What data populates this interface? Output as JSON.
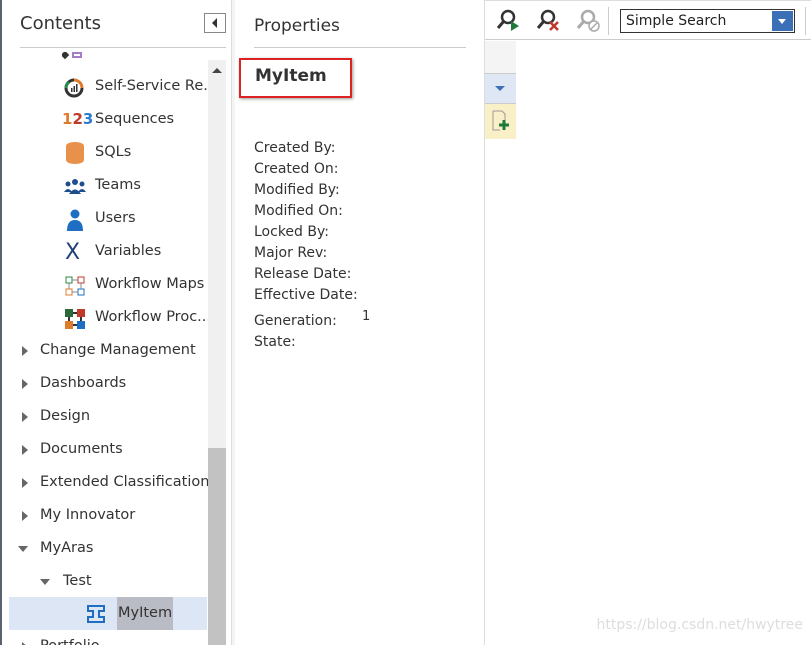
{
  "contents": {
    "title": "Contents",
    "items": [
      {
        "label": "Self-Service Re...",
        "icon": "self-service-report-icon"
      },
      {
        "label": "Sequences",
        "icon": "sequences-123-icon"
      },
      {
        "label": "SQLs",
        "icon": "database-cylinder-icon"
      },
      {
        "label": "Teams",
        "icon": "teams-icon"
      },
      {
        "label": "Users",
        "icon": "user-icon"
      },
      {
        "label": "Variables",
        "icon": "variable-x-icon"
      },
      {
        "label": "Workflow Maps",
        "icon": "workflow-map-icon"
      },
      {
        "label": "Workflow Proc...",
        "icon": "workflow-process-icon"
      }
    ],
    "categories": [
      "Change Management",
      "Dashboards",
      "Design",
      "Documents",
      "Extended Classification",
      "My Innovator"
    ],
    "myaras": "MyAras",
    "test": "Test",
    "myitem": "MyItem",
    "portfolio": "Portfolio"
  },
  "properties": {
    "title": "Properties",
    "item_name": "MyItem",
    "fields": [
      {
        "label": "Created By:",
        "value": ""
      },
      {
        "label": "Created On:",
        "value": ""
      },
      {
        "label": "Modified By:",
        "value": ""
      },
      {
        "label": "Modified On:",
        "value": ""
      },
      {
        "label": "Locked By:",
        "value": ""
      },
      {
        "label": "Major Rev:",
        "value": ""
      },
      {
        "label": "Release Date:",
        "value": ""
      },
      {
        "label": "Effective Date:",
        "value": ""
      },
      {
        "label": "Generation:",
        "value": "1"
      },
      {
        "label": "State:",
        "value": ""
      }
    ]
  },
  "toolbar": {
    "search_mode": "Simple Search"
  },
  "watermark": "https://blog.csdn.net/hwytree",
  "colors": {
    "accent": "#3b6fb6",
    "highlight_border": "#dd2222",
    "selected_row": "#dce6f4"
  }
}
